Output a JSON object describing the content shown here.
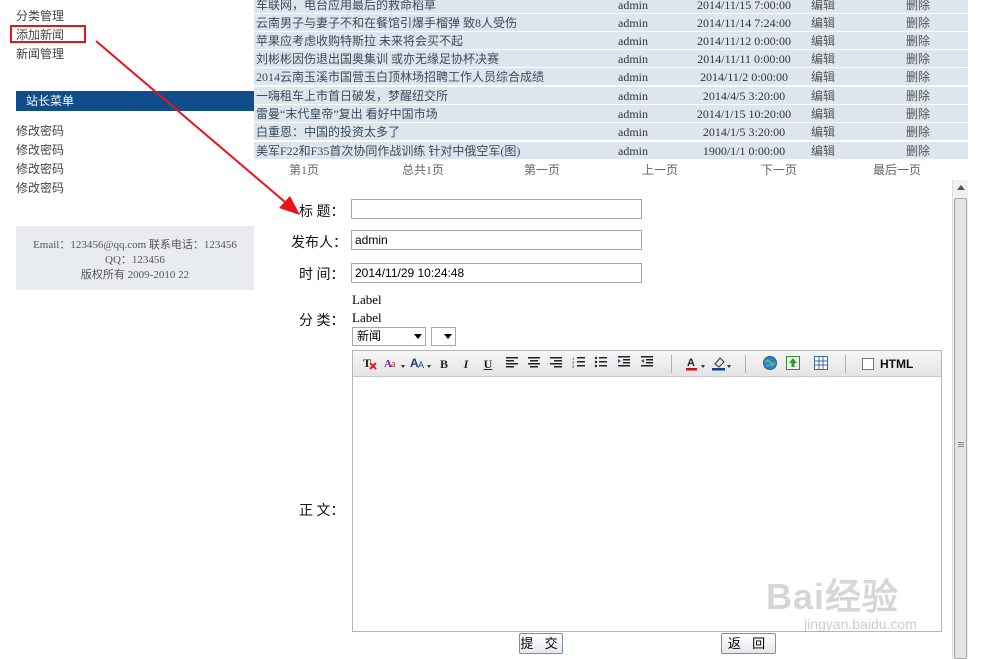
{
  "sidebar": {
    "items": [
      "分类管理",
      "添加新闻",
      "新闻管理"
    ],
    "admin_menu_title": "站长菜单",
    "admin_items": [
      "修改密码",
      "修改密码",
      "修改密码",
      "修改密码"
    ],
    "footer": {
      "line1": "Email：123456@qq.com 联系电话：123456",
      "line2": "QQ：123456",
      "line3": "版权所有 2009-2010 22"
    }
  },
  "news_table": {
    "rows": [
      {
        "title": "车联网，电台应用最后的救命稻草",
        "author": "admin",
        "date": "2014/11/15 7:00:00",
        "edit": "编辑",
        "delete": "删除"
      },
      {
        "title": "云南男子与妻子不和在餐馆引爆手榴弹 致8人受伤",
        "author": "admin",
        "date": "2014/11/14 7:24:00",
        "edit": "编辑",
        "delete": "删除"
      },
      {
        "title": "苹果应考虑收购特斯拉 未来将会买不起",
        "author": "admin",
        "date": "2014/11/12 0:00:00",
        "edit": "编辑",
        "delete": "删除"
      },
      {
        "title": "刘彬彬因伤退出国奥集训 或亦无缘足协杯决赛",
        "author": "admin",
        "date": "2014/11/11 0:00:00",
        "edit": "编辑",
        "delete": "删除"
      },
      {
        "title": "2014云南玉溪市国营玉白顶林场招聘工作人员综合成绩",
        "author": "admin",
        "date": "2014/11/2 0:00:00",
        "edit": "编辑",
        "delete": "删除"
      },
      {
        "title": "一嗨租车上市首日破发，梦醒纽交所",
        "author": "admin",
        "date": "2014/4/5 3:20:00",
        "edit": "编辑",
        "delete": "删除"
      },
      {
        "title": "雷曼“末代皇帝”复出 看好中国市场",
        "author": "admin",
        "date": "2014/1/15 10:20:00",
        "edit": "编辑",
        "delete": "删除"
      },
      {
        "title": "白重恩：中国的投资太多了",
        "author": "admin",
        "date": "2014/1/5 3:20:00",
        "edit": "编辑",
        "delete": "删除"
      },
      {
        "title": "美军F22和F35首次协同作战训练 针对中俄空军(图)",
        "author": "admin",
        "date": "1900/1/1 0:00:00",
        "edit": "编辑",
        "delete": "删除"
      }
    ]
  },
  "pager": {
    "current": "第1页",
    "total": "总共1页",
    "first": "第一页",
    "prev": "上一页",
    "next": "下一页",
    "last": "最后一页"
  },
  "form": {
    "title_label": "标  题：",
    "title_value": "",
    "author_label": "发布人：",
    "author_value": "admin",
    "time_label": "时  间：",
    "time_value": "2014/11/29 10:24:48",
    "category_label": "分  类：",
    "category_label1": "Label",
    "category_label2": "Label",
    "category_select": "新闻",
    "subcategory_select": "",
    "content_label": "正  文：",
    "html_toggle_label": "HTML",
    "submit_label": "提 交",
    "back_label": "返 回"
  },
  "watermark": {
    "brand": "Bai经验",
    "url": "jingyan.baidu.com"
  },
  "colors": {
    "menu_header": "#114d8a",
    "row_bg": "#dde6ee",
    "annotation": "#e8141c"
  }
}
